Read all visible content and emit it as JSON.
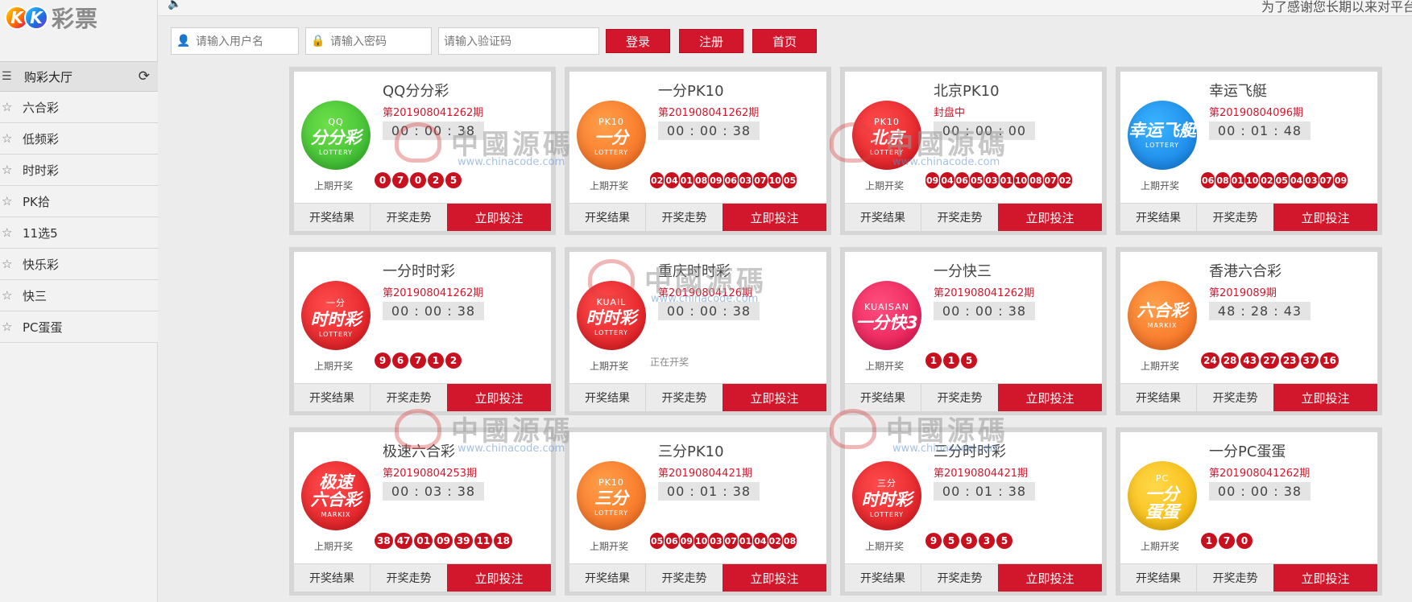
{
  "brand": {
    "logo_letters": [
      "K",
      "K"
    ],
    "logo_text": "彩票"
  },
  "topbar": {
    "marquee": "为了感谢您长期以来对平台的信任与支持，为您"
  },
  "login": {
    "username_placeholder": "请输入用户名",
    "password_placeholder": "请输入密码",
    "captcha_placeholder": "请输入验证码",
    "login_label": "登录",
    "register_label": "注册",
    "home_label": "首页"
  },
  "sidebar": {
    "header": "购彩大厅",
    "items": [
      {
        "label": "六合彩"
      },
      {
        "label": "低频彩"
      },
      {
        "label": "时时彩"
      },
      {
        "label": "PK拾"
      },
      {
        "label": "11选5"
      },
      {
        "label": "快乐彩"
      },
      {
        "label": "快三"
      },
      {
        "label": "PC蛋蛋"
      }
    ]
  },
  "card_labels": {
    "last": "上期开奖",
    "results": "开奖结果",
    "trend": "开奖走势",
    "bet": "立即投注"
  },
  "games": [
    {
      "title": "QQ分分彩",
      "period": "第201908041262期",
      "timer": "00 : 00 : 38",
      "logo_main": "分分彩",
      "logo_sub": "LOTTERY",
      "logo_top": "QQ",
      "balls": [
        "0",
        "7",
        "0",
        "2",
        "5"
      ],
      "status": ""
    },
    {
      "title": "一分PK10",
      "period": "第201908041262期",
      "timer": "00 : 00 : 38",
      "logo_main": "一分",
      "logo_sub": "LOTTERY",
      "logo_top": "PK10",
      "balls": [
        "02",
        "04",
        "01",
        "08",
        "09",
        "06",
        "03",
        "07",
        "10",
        "05"
      ],
      "status": ""
    },
    {
      "title": "北京PK10",
      "period": "封盘中",
      "timer": "00 : 00 : 00",
      "logo_main": "北京",
      "logo_sub": "LOTTERY",
      "logo_top": "PK10",
      "balls": [
        "09",
        "04",
        "06",
        "05",
        "03",
        "01",
        "10",
        "08",
        "07",
        "02"
      ],
      "status": ""
    },
    {
      "title": "幸运飞艇",
      "period": "第20190804096期",
      "timer": "00 : 01 : 48",
      "logo_main": "幸运飞艇",
      "logo_sub": "LOTTERY",
      "logo_top": "",
      "balls": [
        "06",
        "08",
        "01",
        "10",
        "02",
        "05",
        "04",
        "03",
        "07",
        "09"
      ],
      "status": ""
    },
    {
      "title": "一分时时彩",
      "period": "第201908041262期",
      "timer": "00 : 00 : 38",
      "logo_main": "时时彩",
      "logo_sub": "LOTTERY",
      "logo_top": "一分",
      "balls": [
        "9",
        "6",
        "7",
        "1",
        "2"
      ],
      "status": ""
    },
    {
      "title": "重庆时时彩",
      "period": "第20190804126期",
      "timer": "00 : 00 : 38",
      "logo_main": "时时彩",
      "logo_sub": "LOTTERY",
      "logo_top": "KUAIL",
      "balls": [],
      "status": "正在开奖"
    },
    {
      "title": "一分快三",
      "period": "第201908041262期",
      "timer": "00 : 00 : 38",
      "logo_main": "一分快3",
      "logo_sub": "",
      "logo_top": "KUAISAN",
      "balls": [
        "1",
        "1",
        "5"
      ],
      "status": ""
    },
    {
      "title": "香港六合彩",
      "period": "第2019089期",
      "timer": "48 : 28 : 43",
      "logo_main": "六合彩",
      "logo_sub": "MARKIX",
      "logo_top": "",
      "balls": [
        "24",
        "28",
        "43",
        "27",
        "23",
        "37",
        "16"
      ],
      "status": ""
    },
    {
      "title": "极速六合彩",
      "period": "第20190804253期",
      "timer": "00 : 03 : 38",
      "logo_main": "极速\n六合彩",
      "logo_sub": "MARKIX",
      "logo_top": "",
      "balls": [
        "38",
        "47",
        "01",
        "09",
        "39",
        "11",
        "18"
      ],
      "status": ""
    },
    {
      "title": "三分PK10",
      "period": "第20190804421期",
      "timer": "00 : 01 : 38",
      "logo_main": "三分",
      "logo_sub": "LOTTERY",
      "logo_top": "PK10",
      "balls": [
        "05",
        "06",
        "09",
        "10",
        "03",
        "07",
        "01",
        "04",
        "02",
        "08"
      ],
      "status": ""
    },
    {
      "title": "三分时时彩",
      "period": "第20190804421期",
      "timer": "00 : 01 : 38",
      "logo_main": "时时彩",
      "logo_sub": "LOTTERY",
      "logo_top": "三分",
      "balls": [
        "9",
        "5",
        "9",
        "3",
        "5"
      ],
      "status": ""
    },
    {
      "title": "一分PC蛋蛋",
      "period": "第201908041262期",
      "timer": "00 : 00 : 38",
      "logo_main": "一分\n蛋蛋",
      "logo_sub": "",
      "logo_top": "PC",
      "balls": [
        "1",
        "7",
        "0"
      ],
      "status": ""
    }
  ],
  "watermark": {
    "cn": "中國源碼",
    "url": "www.chinacode.com"
  },
  "colors": {
    "accent_red": "#d2162b",
    "ball_red": "#c9101e",
    "period_red": "#d2162b"
  },
  "icons": {
    "speaker": "speaker-icon",
    "user": "user-icon",
    "lock": "lock-icon",
    "menu": "list-icon",
    "refresh": "refresh-icon",
    "star": "star-outline-icon"
  }
}
